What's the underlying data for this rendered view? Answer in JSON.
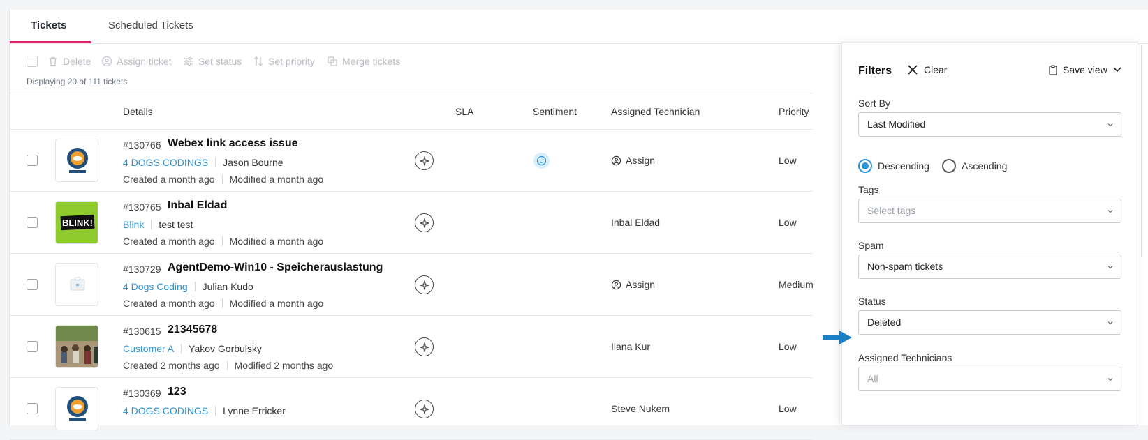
{
  "tabs": [
    {
      "label": "Tickets",
      "active": true
    },
    {
      "label": "Scheduled Tickets",
      "active": false
    }
  ],
  "toolbar": {
    "delete": "Delete",
    "assign": "Assign ticket",
    "set_status": "Set status",
    "set_priority": "Set priority",
    "merge": "Merge tickets"
  },
  "display_count": "Displaying 20 of 111 tickets",
  "columns": {
    "details": "Details",
    "sla": "SLA",
    "sentiment": "Sentiment",
    "assigned_technician": "Assigned Technician",
    "priority": "Priority"
  },
  "tickets": [
    {
      "number": "#130766",
      "title": "Webex link access issue",
      "company": "4 DOGS CODINGS",
      "contact": "Jason Bourne",
      "created": "Created a month ago",
      "modified": "Modified a month ago",
      "technician": "Assign",
      "priority": "Low",
      "thumb": "4dogs",
      "sentiment": "positive"
    },
    {
      "number": "#130765",
      "title": "Inbal Eldad",
      "company": "Blink",
      "contact": "test test",
      "created": "Created a month ago",
      "modified": "Modified a month ago",
      "technician": "Inbal Eldad",
      "priority": "Low",
      "thumb": "blink",
      "logo_text": "BLINK!"
    },
    {
      "number": "#130729",
      "title": "AgentDemo-Win10 - Speicherauslastung",
      "company": "4 Dogs Coding",
      "contact": "Julian Kudo",
      "created": "Created a month ago",
      "modified": "Modified a month ago",
      "technician": "Assign",
      "priority": "Medium",
      "thumb": "briefcase"
    },
    {
      "number": "#130615",
      "title": "21345678",
      "company": "Customer A",
      "contact": "Yakov Gorbulsky",
      "created": "Created 2 months ago",
      "modified": "Modified 2 months ago",
      "technician": "Ilana Kur",
      "priority": "Low",
      "thumb": "photo"
    },
    {
      "number": "#130369",
      "title": "123",
      "company": "4 DOGS CODINGS",
      "contact": "Lynne Erricker",
      "created": "",
      "modified": "",
      "technician": "Steve Nukem",
      "priority": "Low",
      "thumb": "4dogs"
    }
  ],
  "filters": {
    "title": "Filters",
    "clear": "Clear",
    "save_view": "Save view",
    "sort_by_label": "Sort By",
    "sort_by_value": "Last Modified",
    "descending": "Descending",
    "ascending": "Ascending",
    "sort_order": "descending",
    "tags_label": "Tags",
    "tags_placeholder": "Select tags",
    "spam_label": "Spam",
    "spam_value": "Non-spam tickets",
    "status_label": "Status",
    "status_value": "Deleted",
    "technicians_label": "Assigned Technicians",
    "technicians_value": "All"
  },
  "colors": {
    "accent": "#e0236f",
    "link": "#2a93d5",
    "annotation_arrow": "#1a7fc4"
  }
}
